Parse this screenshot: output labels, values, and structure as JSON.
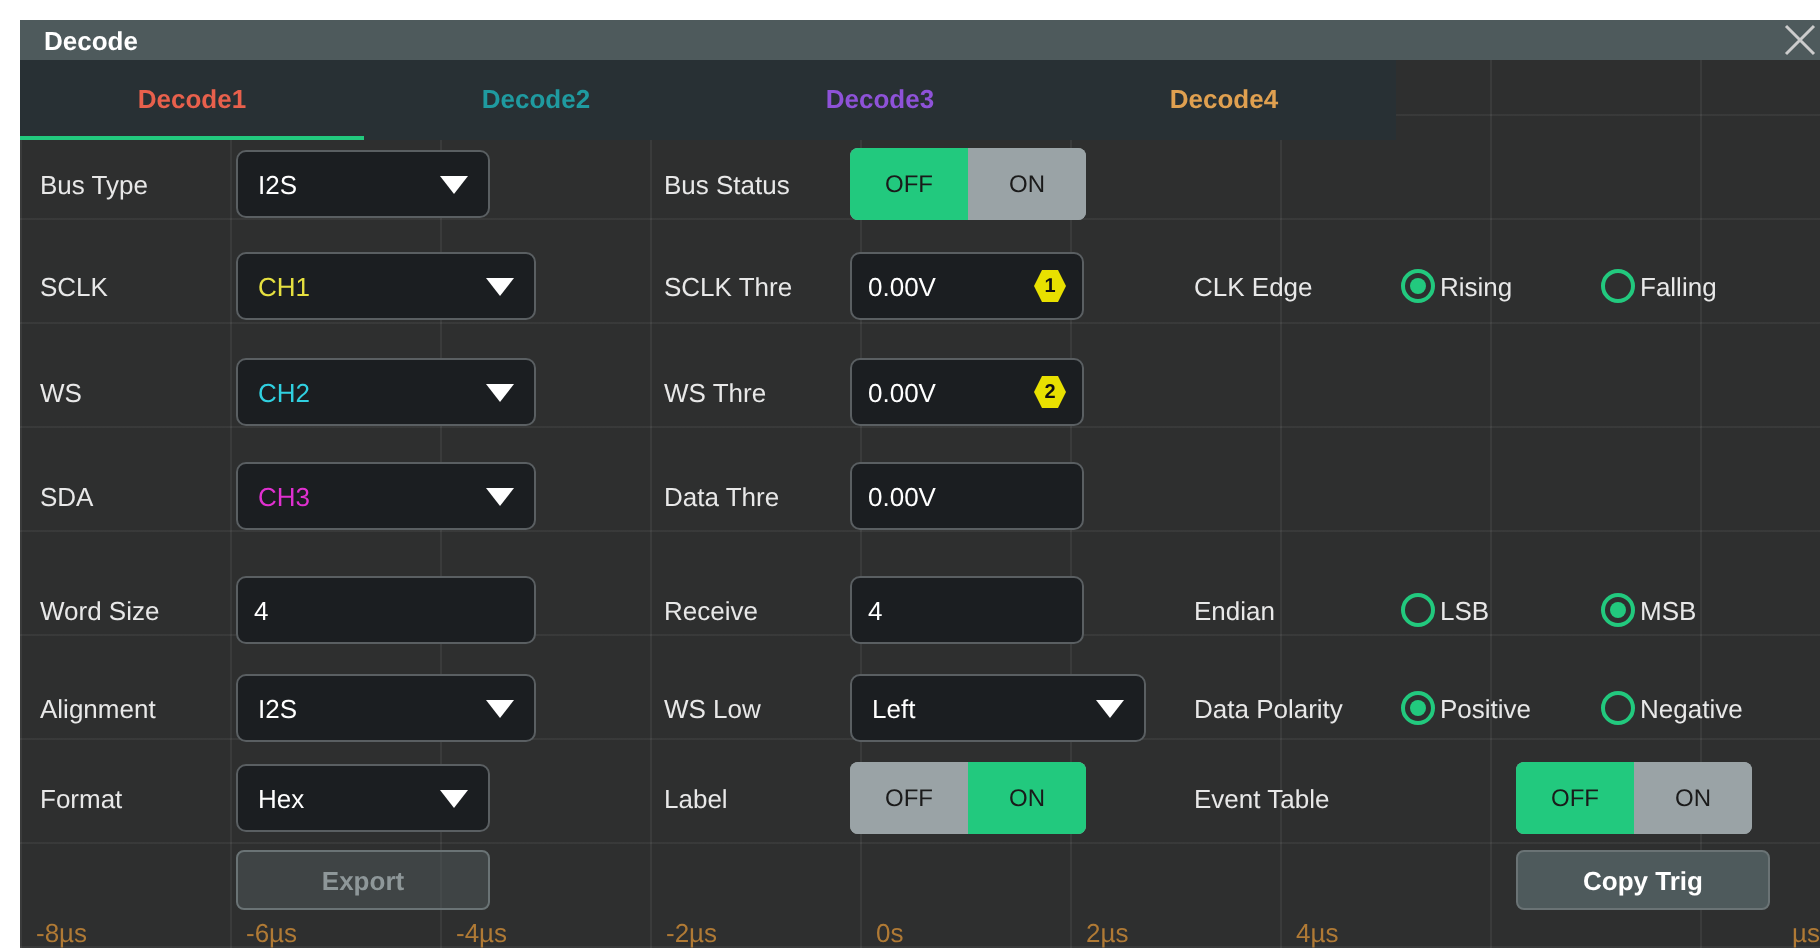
{
  "window": {
    "title": "Decode"
  },
  "tabs": [
    {
      "label": "Decode1",
      "color": "#e8604c",
      "selected": true
    },
    {
      "label": "Decode2",
      "color": "#1f9aa0",
      "selected": false
    },
    {
      "label": "Decode3",
      "color": "#8e52d8",
      "selected": false
    },
    {
      "label": "Decode4",
      "color": "#e0a050",
      "selected": false
    }
  ],
  "sections": [
    [
      {
        "left": {
          "label": "Bus Type",
          "control": {
            "kind": "dropdown",
            "value": "I2S"
          }
        },
        "mid": {
          "label": "Bus Status",
          "control": {
            "kind": "toggle",
            "options": [
              {
                "label": "OFF",
                "selected": true
              },
              {
                "label": "ON",
                "selected": false
              }
            ]
          }
        }
      }
    ],
    [
      {
        "left": {
          "label": "SCLK",
          "control": {
            "kind": "dropdown",
            "value": "CH1",
            "color": "#e6e040"
          }
        },
        "mid": {
          "label": "SCLK Thre",
          "control": {
            "kind": "input",
            "value": "0.00V",
            "marker": "1"
          }
        },
        "right": {
          "label": "CLK Edge",
          "control": {
            "kind": "radios",
            "options": [
              {
                "label": "Rising",
                "selected": true
              },
              {
                "label": "Falling",
                "selected": false
              }
            ]
          }
        }
      },
      {
        "left": {
          "label": "WS",
          "control": {
            "kind": "dropdown",
            "value": "CH2",
            "color": "#30d0e0"
          }
        },
        "mid": {
          "label": "WS Thre",
          "control": {
            "kind": "input",
            "value": "0.00V",
            "marker": "2"
          }
        }
      },
      {
        "left": {
          "label": "SDA",
          "control": {
            "kind": "dropdown",
            "value": "CH3",
            "color": "#e030d0"
          }
        },
        "mid": {
          "label": "Data Thre",
          "control": {
            "kind": "input",
            "value": "0.00V"
          }
        }
      }
    ],
    [
      {
        "left": {
          "label": "Word Size",
          "control": {
            "kind": "input",
            "value": "4"
          }
        },
        "mid": {
          "label": "Receive",
          "control": {
            "kind": "input",
            "value": "4"
          }
        },
        "right": {
          "label": "Endian",
          "control": {
            "kind": "radios",
            "options": [
              {
                "label": "LSB",
                "selected": false
              },
              {
                "label": "MSB",
                "selected": true
              }
            ]
          }
        }
      },
      {
        "left": {
          "label": "Alignment",
          "control": {
            "kind": "dropdown",
            "value": "I2S"
          }
        },
        "mid": {
          "label": "WS Low",
          "control": {
            "kind": "dropdown",
            "value": "Left"
          }
        },
        "right": {
          "label": "Data Polarity",
          "control": {
            "kind": "radios",
            "options": [
              {
                "label": "Positive",
                "selected": true
              },
              {
                "label": "Negative",
                "selected": false
              }
            ]
          }
        }
      },
      {
        "left": {
          "label": "Format",
          "control": {
            "kind": "dropdown",
            "value": "Hex"
          }
        },
        "mid": {
          "label": "Label",
          "control": {
            "kind": "toggle",
            "options": [
              {
                "label": "OFF",
                "selected": false
              },
              {
                "label": "ON",
                "selected": true
              }
            ]
          }
        },
        "right": {
          "label": "Event Table",
          "control": {
            "kind": "toggle",
            "options": [
              {
                "label": "OFF",
                "selected": true
              },
              {
                "label": "ON",
                "selected": false
              }
            ]
          }
        }
      },
      {
        "left": {
          "control": {
            "kind": "button",
            "label": "Export",
            "disabled": true
          }
        },
        "right": {
          "control": {
            "kind": "button",
            "label": "Copy Trig",
            "disabled": false
          }
        }
      }
    ]
  ],
  "axis_labels": [
    "-8µs",
    "-6µs",
    "-4µs",
    "-2µs",
    "0s",
    "2µs",
    "4µs",
    "µs"
  ]
}
